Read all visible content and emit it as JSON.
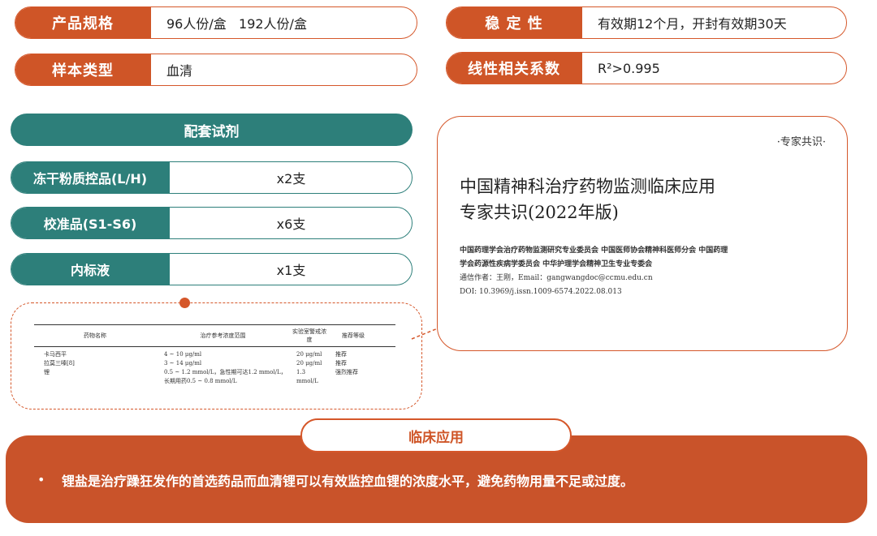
{
  "specs_left": [
    {
      "label": "产品规格",
      "value": "96人份/盒   192人份/盒"
    },
    {
      "label": "样本类型",
      "value": "血清"
    }
  ],
  "specs_right": [
    {
      "label": "稳 定 性",
      "value": "有效期12个月，开封有效期30天"
    },
    {
      "label": "线性相关系数",
      "value": "R²>0.995"
    }
  ],
  "reagents": {
    "title": "配套试剂",
    "items": [
      {
        "label": "冻干粉质控品(L/H)",
        "value": "x2支"
      },
      {
        "label": "校准品(S1-S6)",
        "value": "x6支"
      },
      {
        "label": "内标液",
        "value": "x1支"
      }
    ]
  },
  "ref_table": {
    "headers": [
      "药物名称",
      "治疗参考浓度范围",
      "实验室警戒浓度",
      "推荐等级"
    ],
    "rows": [
      [
        "卡马西平",
        "4 ~ 10 μg/ml",
        "20 μg/ml",
        "推荐"
      ],
      [
        "拉莫三嗪[8]",
        "3 ~ 14 μg/ml",
        "20 μg/ml",
        "推荐"
      ],
      [
        "锂",
        "0.5 ~ 1.2 mmol/L，急性期可达1.2 mmol/L，长期用药0.5 ~ 0.8 mmol/L",
        "1.3 mmol/L",
        "强烈推荐"
      ]
    ]
  },
  "paper": {
    "tag": "·专家共识·",
    "title_line1": "中国精神科治疗药物监测临床应用",
    "title_line2": "专家共识(2022年版)",
    "authors_line1": "中国药理学会治疗药物监测研究专业委员会  中国医师协会精神科医师分会  中国药理",
    "authors_line2": "学会药源性疾病学委员会  中华护理学会精神卫生专业专委会",
    "contact": "通信作者：王刚，Email：gangwangdoc@ccmu.edu.cn",
    "doi": "DOI: 10.3969/j.issn.1009-6574.2022.08.013"
  },
  "clinical": {
    "title": "临床应用",
    "bullet": "•",
    "text": "锂盐是治疗躁狂发作的首选药品而血清锂可以有效监控血锂的浓度水平，避免药物用量不足或过度。"
  },
  "colors": {
    "accent": "#cf5527",
    "teal": "#2d7f7a"
  }
}
